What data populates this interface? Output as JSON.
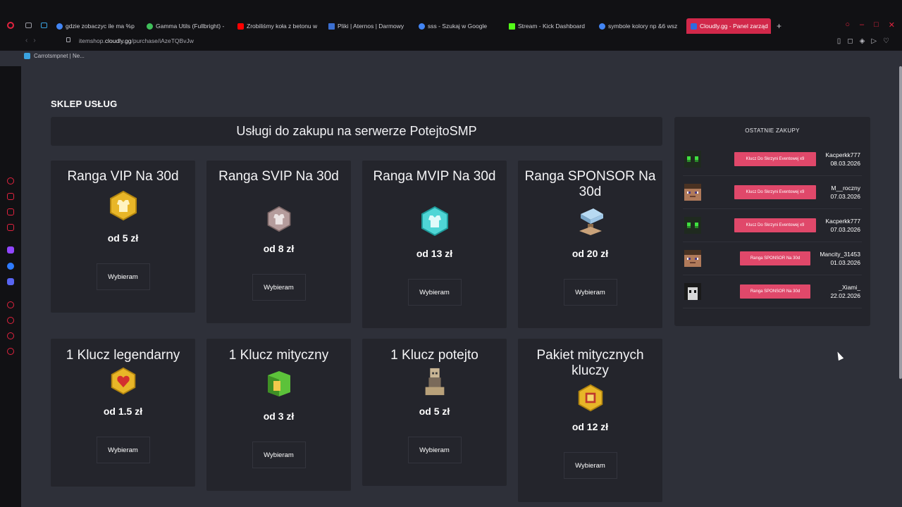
{
  "browser": {
    "tabs": [
      {
        "label": "gdzie zobaczyc ile ma %p",
        "color": "#4285f4"
      },
      {
        "label": "Gamma Utils (Fullbright) -",
        "color": "#3fbf5a"
      },
      {
        "label": "Zrobiliśmy koła z betonu w",
        "color": "#ff0000"
      },
      {
        "label": "Pliki | Aternos | Darmowy",
        "color": "#3b6fd1"
      },
      {
        "label": "sss - Szukaj w Google",
        "color": "#4285f4"
      },
      {
        "label": "Stream - Kick Dashboard",
        "color": "#53fc18"
      },
      {
        "label": "symbole kolory np &6 wsz",
        "color": "#4285f4"
      },
      {
        "label": "Cloudly.gg - Panel zarząd",
        "color": "#2d6cdf"
      }
    ],
    "add_tab": "+",
    "url_prefix": "itemshop.",
    "url_domain": "cloudly.gg",
    "url_path": "/purchase/iAzeTQBvJw",
    "bookmark": "Carrotsmpnet | Ne..."
  },
  "shop": {
    "section_title": "SKLEP USŁUG",
    "banner": "Usługi do zakupu na serwerze PotejtoSMP",
    "button_label": "Wybieram",
    "cards": [
      {
        "name": "Ranga VIP Na 30d",
        "price": "od 5 zł",
        "icon": "vip-rank-icon",
        "icon_color": "#e8b628"
      },
      {
        "name": "Ranga SVIP Na 30d",
        "price": "od 8 zł",
        "icon": "svip-rank-icon",
        "icon_color": "#b59c9c"
      },
      {
        "name": "Ranga MVIP Na 30d",
        "price": "od 13 zł",
        "icon": "mvip-rank-icon",
        "icon_color": "#4fd6d6"
      },
      {
        "name": "Ranga SPONSOR Na 30d",
        "price": "od 20 zł",
        "icon": "sponsor-anvil-icon",
        "icon_color": "#9ec6e6"
      },
      {
        "name": "1 Klucz legendarny",
        "price": "od 1.5 zł",
        "icon": "legendary-key-icon",
        "icon_color": "#e8b628"
      },
      {
        "name": "1 Klucz mityczny",
        "price": "od 3 zł",
        "icon": "mythic-key-icon",
        "icon_color": "#5cc23a"
      },
      {
        "name": "1 Klucz potejto",
        "price": "od 5 zł",
        "icon": "potejto-key-icon",
        "icon_color": "#b8a17a"
      },
      {
        "name": "Pakiet mitycznych kluczy",
        "price": "od 12 zł",
        "icon": "mythic-keys-pack-icon",
        "icon_color": "#e8b628"
      }
    ]
  },
  "recent": {
    "title": "OSTATNIE ZAKUPY",
    "items": [
      {
        "item": "Klucz Do Skrzyni Eventowej x9",
        "user": "Kacperkk777",
        "date": "08.03.2026",
        "skin": "green-eyes"
      },
      {
        "item": "Klucz Do Skrzyni Eventowej x9",
        "user": "M__roczny",
        "date": "07.03.2026",
        "skin": "steve"
      },
      {
        "item": "Klucz Do Skrzyni Eventowej x9",
        "user": "Kacperkk777",
        "date": "07.03.2026",
        "skin": "green-eyes"
      },
      {
        "item": "Ranga SPONSOR Na 30d",
        "user": "Mancity_31453",
        "date": "01.03.2026",
        "skin": "steve"
      },
      {
        "item": "Ranga SPONSOR Na 30d",
        "user": "_Xiami_",
        "date": "22.02.2026",
        "skin": "mono"
      }
    ]
  },
  "colors": {
    "accent": "#e0486a",
    "card_bg": "#24252c",
    "page_bg": "#2e3039",
    "opera_red": "#e2233f"
  }
}
